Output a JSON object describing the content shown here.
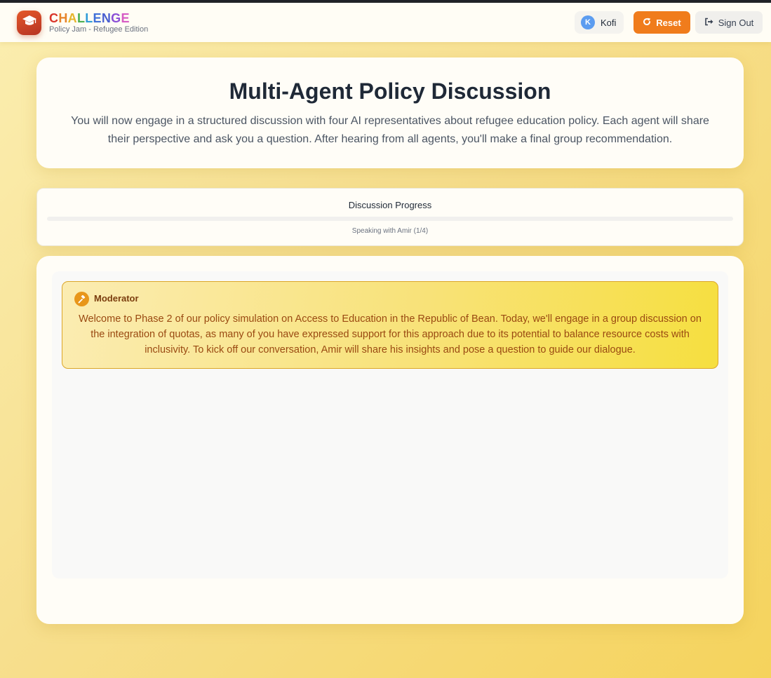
{
  "app": {
    "brand_letters": [
      {
        "char": "C",
        "color": "#d9362b"
      },
      {
        "char": "H",
        "color": "#e7842a"
      },
      {
        "char": "A",
        "color": "#e6b52b"
      },
      {
        "char": "L",
        "color": "#4caf50"
      },
      {
        "char": "L",
        "color": "#2f9bd8"
      },
      {
        "char": "E",
        "color": "#3f6fd8"
      },
      {
        "char": "N",
        "color": "#4a5fd0"
      },
      {
        "char": "G",
        "color": "#8b4fd6"
      },
      {
        "char": "E",
        "color": "#d65bc4"
      }
    ],
    "subtitle": "Policy Jam - Refugee Edition",
    "logo_icon": "graduation-cap-icon"
  },
  "header": {
    "user": {
      "initial": "K",
      "name": "Kofi"
    },
    "reset_label": "Reset",
    "reset_icon": "redo-icon",
    "signout_label": "Sign Out",
    "signout_icon": "sign-out-icon",
    "accent": "#f07c1c"
  },
  "intro": {
    "title": "Multi-Agent Policy Discussion",
    "description": "You will now engage in a structured discussion with four AI representatives about refugee education policy. Each agent will share their perspective and ask you a question. After hearing from all agents, you'll make a final group recommendation."
  },
  "progress": {
    "title": "Discussion Progress",
    "value": 0,
    "status": "Speaking with Amir (1/4)"
  },
  "chat": {
    "messages": [
      {
        "sender": "Moderator",
        "icon": "gavel-icon",
        "text": "Welcome to Phase 2 of our policy simulation on Access to Education in the Republic of Bean. Today, we'll engage in a group discussion on the integration of quotas, as many of you have expressed support for this approach due to its potential to balance resource costs with inclusivity. To kick off our conversation, Amir will share his insights and pose a question to guide our dialogue."
      }
    ]
  }
}
